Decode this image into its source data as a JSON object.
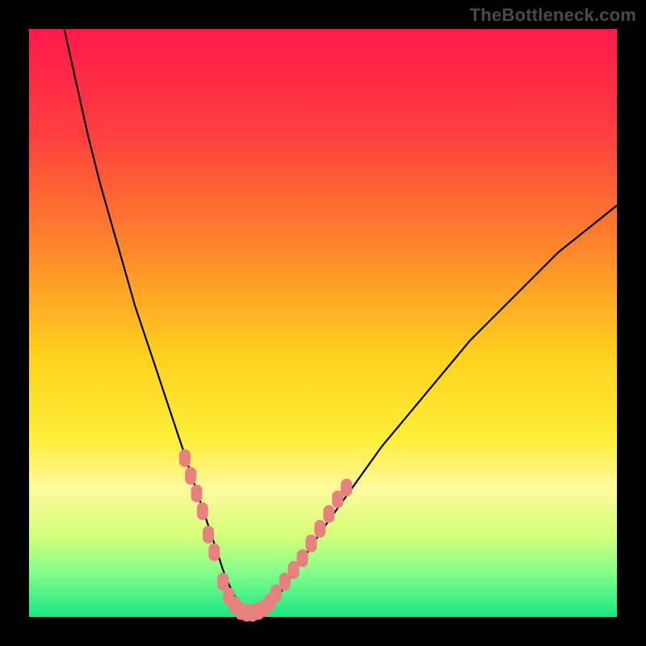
{
  "watermark": "TheBottleneck.com",
  "colors": {
    "frame": "#000000",
    "gradient_stops": [
      {
        "pct": 0,
        "color": "#ff1a4b"
      },
      {
        "pct": 18,
        "color": "#ff3f3f"
      },
      {
        "pct": 38,
        "color": "#ff8a2a"
      },
      {
        "pct": 56,
        "color": "#ffd21f"
      },
      {
        "pct": 70,
        "color": "#ffef3a"
      },
      {
        "pct": 78,
        "color": "#fff99e"
      },
      {
        "pct": 86,
        "color": "#d6ff7a"
      },
      {
        "pct": 92,
        "color": "#8aff8a"
      },
      {
        "pct": 100,
        "color": "#17e884"
      }
    ],
    "curve": "#000000",
    "marker": "#e8807f"
  },
  "chart_data": {
    "type": "line",
    "title": "",
    "xlabel": "",
    "ylabel": "",
    "xlim": [
      0,
      100
    ],
    "ylim": [
      0,
      100
    ],
    "note": "V-shaped bottleneck curve. x,y normalized to 0–100 within the colored plot area; y=0 bottom, y=100 top. Values estimated from pixels.",
    "series": [
      {
        "name": "bottleneck-curve",
        "x": [
          6,
          8,
          10,
          12,
          14,
          16,
          18,
          20,
          22,
          24,
          26,
          28,
          29,
          30,
          31,
          32,
          33,
          34,
          35,
          36,
          37,
          38,
          39,
          40,
          42,
          44,
          46,
          50,
          55,
          60,
          65,
          70,
          75,
          80,
          85,
          90,
          95,
          100
        ],
        "y": [
          100,
          91,
          82,
          74,
          67,
          60,
          53,
          47,
          41,
          35,
          29,
          23,
          20,
          17,
          14,
          11,
          8,
          5.5,
          3.5,
          2,
          1,
          0.5,
          0.5,
          1,
          3,
          6,
          9,
          15,
          22,
          29,
          35,
          41,
          47,
          52,
          57,
          62,
          66,
          70
        ]
      }
    ],
    "markers": {
      "name": "highlight-dots",
      "note": "Salmon rounded markers clustered near the valley along the curve.",
      "points": [
        {
          "x": 26.5,
          "y": 27
        },
        {
          "x": 27.5,
          "y": 24
        },
        {
          "x": 28.5,
          "y": 21
        },
        {
          "x": 29.5,
          "y": 18
        },
        {
          "x": 30.5,
          "y": 14
        },
        {
          "x": 31.5,
          "y": 11
        },
        {
          "x": 33.0,
          "y": 6
        },
        {
          "x": 34.0,
          "y": 3.5
        },
        {
          "x": 35.0,
          "y": 2
        },
        {
          "x": 36.0,
          "y": 1
        },
        {
          "x": 37.0,
          "y": 0.7
        },
        {
          "x": 38.0,
          "y": 0.7
        },
        {
          "x": 39.0,
          "y": 1
        },
        {
          "x": 40.0,
          "y": 1.5
        },
        {
          "x": 41.0,
          "y": 2.5
        },
        {
          "x": 42.0,
          "y": 4
        },
        {
          "x": 43.5,
          "y": 6
        },
        {
          "x": 45.0,
          "y": 8
        },
        {
          "x": 46.5,
          "y": 10
        },
        {
          "x": 48.0,
          "y": 12.5
        },
        {
          "x": 49.5,
          "y": 15
        },
        {
          "x": 51.0,
          "y": 17.5
        },
        {
          "x": 52.5,
          "y": 20
        },
        {
          "x": 54.0,
          "y": 22
        }
      ]
    }
  }
}
